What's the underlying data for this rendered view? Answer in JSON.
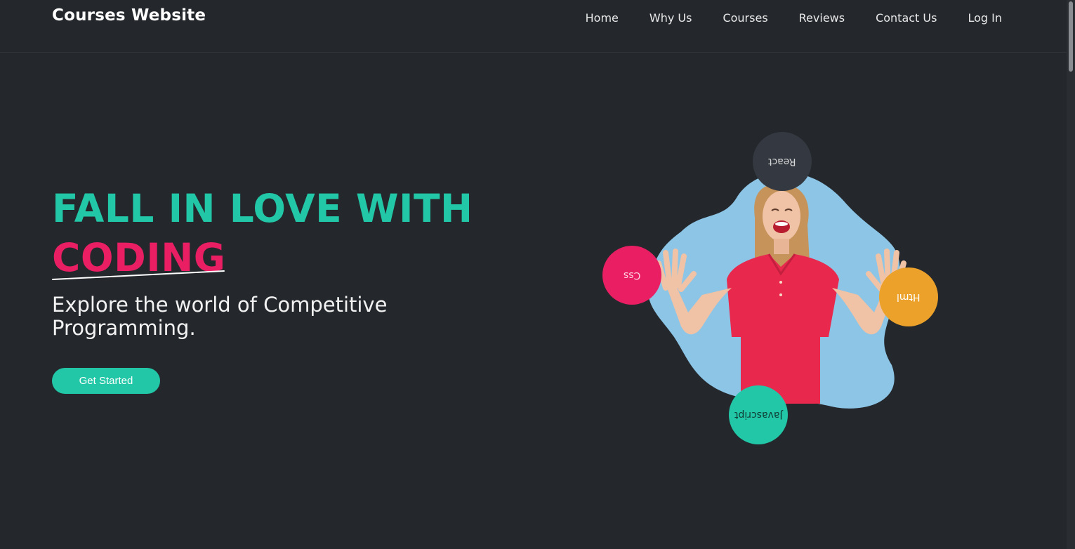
{
  "navbar": {
    "brand": "Courses Website",
    "links": [
      "Home",
      "Why Us",
      "Courses",
      "Reviews",
      "Contact Us",
      "Log In"
    ]
  },
  "hero": {
    "title_line1": "FALL IN LOVE WITH",
    "title_line2": "CODING",
    "subtitle": "Explore the world of Competitive Programming.",
    "cta_label": "Get Started"
  },
  "bubbles": {
    "react": "React",
    "css": "Css",
    "html": "Html",
    "javascript": "Javascript"
  },
  "colors": {
    "background": "#24282d",
    "accent_teal": "#22c7a7",
    "accent_pink": "#e91e63",
    "accent_orange": "#eba12a",
    "blob_blue": "#8cc5e6"
  }
}
